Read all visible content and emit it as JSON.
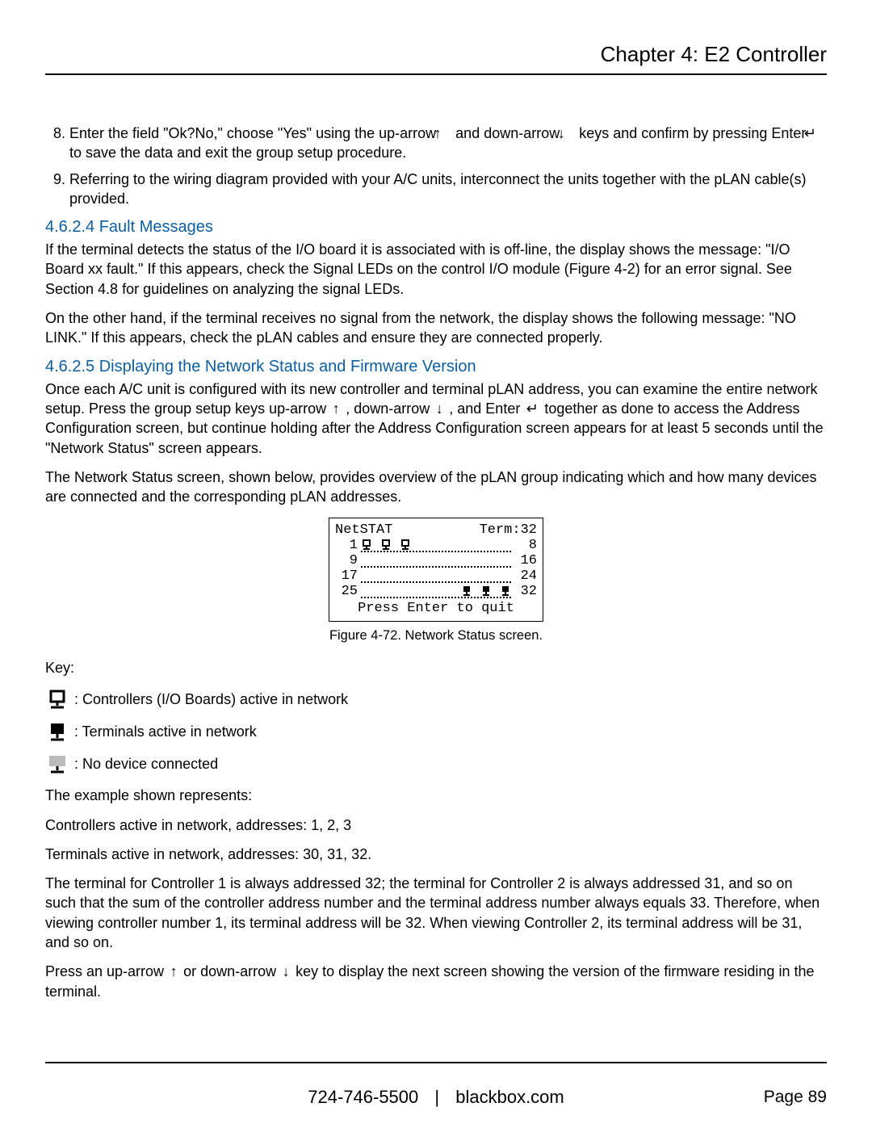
{
  "chapter": "Chapter 4: E2 Controller",
  "steps": {
    "s8_a": "8. Enter the field \"Ok?No,\" choose \"Yes\" using the up-arrow ",
    "s8_b": " and down-arrow ",
    "s8_c": " keys and confirm by pressing Enter ",
    "s8_d": " to save the data and exit the group setup procedure.",
    "s9": "9. Referring to the wiring diagram provided with your A/C units, interconnect the units together with the pLAN cable(s) provided."
  },
  "h4624": "4.6.2.4 Fault Messages",
  "p_fault1": "If the terminal detects the status of the I/O board it is associated with is off-line, the display shows the message: \"I/O Board xx fault.\" If this appears, check the Signal LEDs on the control I/O module (Figure 4-2) for an error signal. See Section 4.8 for guidelines on analyzing the signal LEDs.",
  "p_fault2": "On the other hand, if the terminal receives no signal from the network, the display shows the following message: \"NO LINK.\" If this appears, check the pLAN cables and ensure they are connected properly.",
  "h4625": "4.6.2.5 Displaying the Network Status and Firmware Version",
  "p_net1_a": "Once each A/C unit is configured with its new controller and terminal pLAN address, you can examine the entire network setup. Press the group setup keys up-arrow ",
  "p_net1_b": " , down-arrow ",
  "p_net1_c": " , and Enter ",
  "p_net1_d": " together as done to access the Address Configuration screen, but continue holding after the Address Configuration screen appears for at least 5 seconds until the \"Network Status\" screen appears.",
  "p_net2": "The Network Status screen, shown below, provides overview of the pLAN group indicating which and how many devices are connected and the corresponding pLAN addresses.",
  "fig_header_left": "NetSTAT",
  "fig_header_right": "Term:32",
  "fig_rows": [
    {
      "left": "1",
      "right": "8"
    },
    {
      "left": "9",
      "right": "16"
    },
    {
      "left": "17",
      "right": "24"
    },
    {
      "left": "25",
      "right": "32"
    }
  ],
  "fig_footer": "Press Enter to quit",
  "fig_caption": "Figure 4-72. Network Status screen.",
  "key_label": "Key:",
  "key1": ": Controllers (I/O Boards) active in network",
  "key2": ": Terminals active in network",
  "key3": ": No device connected",
  "example_intro": "The example shown represents:",
  "example_ctrl": "Controllers active in network, addresses: 1, 2, 3",
  "example_term": "Terminals active in network, addresses: 30, 31, 32.",
  "p_term_addr": "The terminal for Controller 1 is always addressed 32; the terminal for Controller 2 is always addressed 31, and so on such that the sum of the controller address number and the terminal address number always equals 33. Therefore, when viewing controller number 1, its terminal address will be 32. When viewing Controller 2, its terminal address will be 31, and so on.",
  "p_press_a": "Press an up-arrow ",
  "p_press_b": " or down-arrow ",
  "p_press_c": " key to display the next screen showing the version of the firmware residing in the terminal.",
  "footer_phone": "724-746-5500",
  "footer_sep": "|",
  "footer_site": "blackbox.com",
  "footer_page": "Page 89",
  "chart_data": {
    "type": "table",
    "title": "NetSTAT  Term:32",
    "note": "Network status grid; rows labeled by starting address, columns span 8 addresses each. Filled icons indicate device at that address.",
    "rows": [
      {
        "range_start": 1,
        "range_end": 8,
        "controllers_at": [
          1,
          2,
          3
        ],
        "terminals_at": []
      },
      {
        "range_start": 9,
        "range_end": 16,
        "controllers_at": [],
        "terminals_at": []
      },
      {
        "range_start": 17,
        "range_end": 24,
        "controllers_at": [],
        "terminals_at": []
      },
      {
        "range_start": 25,
        "range_end": 32,
        "controllers_at": [],
        "terminals_at": [
          30,
          31,
          32
        ]
      }
    ],
    "footer": "Press Enter to quit"
  }
}
